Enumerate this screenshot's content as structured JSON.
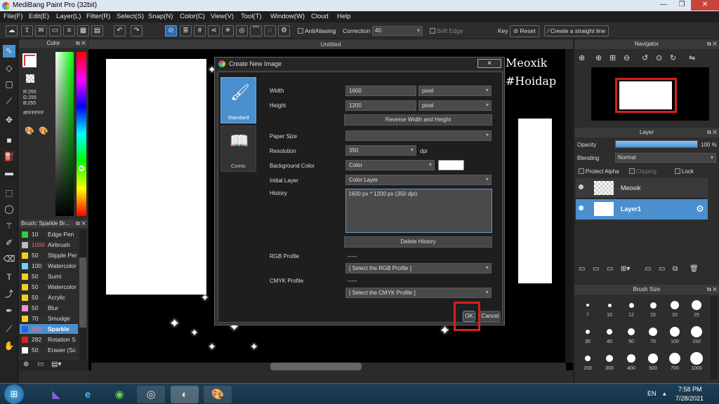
{
  "app": {
    "title": "MediBang Paint Pro (32bit)"
  },
  "menu": [
    "File(F)",
    "Edit(E)",
    "Layer(L)",
    "Filter(R)",
    "Select(S)",
    "Snap(N)",
    "Color(C)",
    "View(V)",
    "Tool(T)",
    "Window(W)",
    "Cloud",
    "Help"
  ],
  "toolbar": {
    "antialiasing_label": "AntiAliasing",
    "correction_label": "Correction",
    "correction_value": "40",
    "soft_edge_label": "Soft Edge",
    "key_label": "Key",
    "reset_label": "Reset",
    "straight_line_label": "Create a straight line"
  },
  "color_panel": {
    "title": "Color",
    "r": "R:255",
    "g": "G:255",
    "b": "B:255",
    "hex": "#FFFFFF"
  },
  "brush_panel": {
    "title": "Brush: Sparkle Br...",
    "items": [
      {
        "size": "10",
        "name": "Edge Pen",
        "color": "#2ecc40"
      },
      {
        "size": "1000",
        "name": "Airbrush",
        "color": "#bbbbbb",
        "size_color": "#ff6a6a"
      },
      {
        "size": "50",
        "name": "Stipple Pen",
        "color": "#f1d11f"
      },
      {
        "size": "100",
        "name": "Watercolor",
        "color": "#6fcff5"
      },
      {
        "size": "50",
        "name": "Sumi",
        "color": "#f1d11f"
      },
      {
        "size": "50",
        "name": "Watercolor",
        "color": "#f1d11f"
      },
      {
        "size": "50",
        "name": "Acrylic",
        "color": "#f1d11f"
      },
      {
        "size": "50",
        "name": "Blur",
        "color": "#f08fd0"
      },
      {
        "size": "70",
        "name": "Smudge",
        "color": "#f1d11f"
      },
      {
        "size": "200",
        "name": "Sparkle",
        "color": "#3060e0",
        "size_color": "#ff6a6a",
        "selected": true
      },
      {
        "size": "282",
        "name": "Rotation S",
        "color": "#e02020"
      },
      {
        "size": "50",
        "name": "Eraser (Sc",
        "color": "#ffffff"
      }
    ]
  },
  "canvas": {
    "tab_title": "Untitled",
    "overlay_text_1": "Meoxik",
    "overlay_text_2": "#Hoidap"
  },
  "dialog": {
    "title": "Create New Image",
    "close_label": "×",
    "tabs": [
      {
        "label": "Standard",
        "active": true
      },
      {
        "label": "Comic",
        "active": false
      }
    ],
    "width_label": "Width",
    "width_value": "1600",
    "width_unit": "pixel",
    "height_label": "Height",
    "height_value": "1200",
    "height_unit": "pixel",
    "reverse_button": "Reverse Width and Height",
    "paper_size_label": "Paper Size",
    "paper_size_value": "",
    "resolution_label": "Resolution",
    "resolution_value": "350",
    "resolution_unit": "dpi",
    "background_label": "Background Color",
    "background_value": "Color",
    "initial_layer_label": "Initial Layer",
    "initial_layer_value": "Color Layer",
    "history_label": "History",
    "history_value": "1600 px * 1200 px (350 dpi)",
    "delete_history_button": "Delete History",
    "rgb_profile_label": "RGB Profile",
    "rgb_profile_dashes": "-----",
    "rgb_profile_value": "[ Select the RGB Profile ]",
    "cmyk_profile_label": "CMYK Profile",
    "cmyk_profile_dashes": "-----",
    "cmyk_profile_value": "[ Select the CMYK Profile ]",
    "ok_label": "OK",
    "cancel_label": "Cancel"
  },
  "navigator": {
    "title": "Navigator"
  },
  "layer_panel": {
    "title": "Layer",
    "opacity_label": "Opacity",
    "opacity_value": "100 %",
    "opacity_fraction": 1.0,
    "blending_label": "Blending",
    "blending_value": "Normal",
    "protect_alpha_label": "Protect Alpha",
    "clipping_label": "Clipping",
    "lock_label": "Lock",
    "layers": [
      {
        "name": "Meoxik",
        "selected": false
      },
      {
        "name": "Layer1",
        "selected": true
      }
    ]
  },
  "brush_size_panel": {
    "title": "Brush Size",
    "sizes": [
      "7",
      "10",
      "12",
      "15",
      "20",
      "25",
      "30",
      "40",
      "50",
      "70",
      "100",
      "150",
      "200",
      "300",
      "400",
      "500",
      "700",
      "1000"
    ]
  },
  "taskbar": {
    "language": "EN",
    "time": "7:58 PM",
    "date": "7/28/2021"
  }
}
